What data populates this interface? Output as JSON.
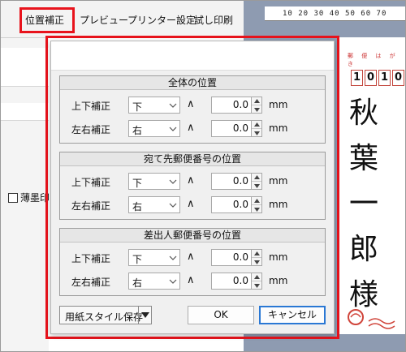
{
  "menu": {
    "items": [
      "位置補正",
      "プレビュー",
      "プリンター設定",
      "試し印刷"
    ],
    "active_index": 0
  },
  "left_panel": {
    "checkbox_label": "薄墨印",
    "checked": false
  },
  "preview": {
    "ruler_text": "10 20 30 40 50 60 70",
    "postcard_header": "郵 便 は が き",
    "zip_digits": [
      "1",
      "0",
      "1",
      "0"
    ],
    "recipient_name": [
      "秋",
      "葉",
      "一",
      "郎",
      "様"
    ]
  },
  "dialog": {
    "groups": [
      {
        "title": "全体の位置",
        "rows": [
          {
            "label": "上下補正",
            "direction": "下",
            "value": "0.0",
            "unit": "mm"
          },
          {
            "label": "左右補正",
            "direction": "右",
            "value": "0.0",
            "unit": "mm"
          }
        ]
      },
      {
        "title": "宛て先郵便番号の位置",
        "rows": [
          {
            "label": "上下補正",
            "direction": "下",
            "value": "0.0",
            "unit": "mm"
          },
          {
            "label": "左右補正",
            "direction": "右",
            "value": "0.0",
            "unit": "mm"
          }
        ]
      },
      {
        "title": "差出人郵便番号の位置",
        "rows": [
          {
            "label": "上下補正",
            "direction": "下",
            "value": "0.0",
            "unit": "mm"
          },
          {
            "label": "左右補正",
            "direction": "右",
            "value": "0.0",
            "unit": "mm"
          }
        ]
      }
    ],
    "caret_symbol": "∧",
    "buttons": {
      "save_style": "用紙スタイル保存",
      "ok": "OK",
      "cancel": "キャンセル"
    }
  },
  "colors": {
    "highlight": "#e8131c",
    "accent": "#2a78d4",
    "zip_border": "#c2443a"
  }
}
